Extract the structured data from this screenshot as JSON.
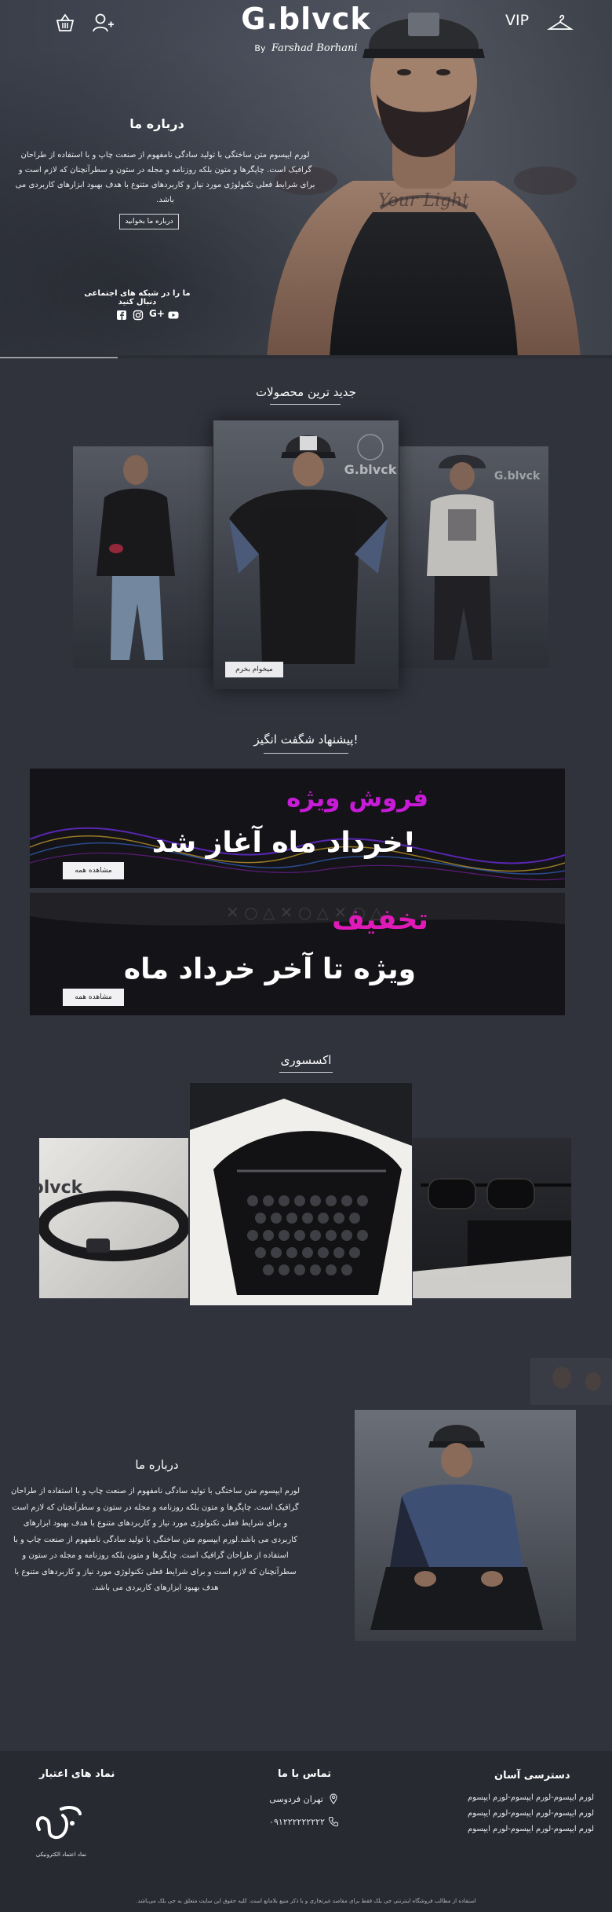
{
  "header": {
    "brand": "G.blvck",
    "by_label": "By",
    "signature": "Farshad Borhani",
    "vip_label": "VIP"
  },
  "hero": {
    "about_title": "درباره ما",
    "about_text": "لورم ایپسوم متن ساختگی با تولید سادگی نامفهوم از صنعت چاپ و با استفاده از طراحان گرافیک است. چاپگرها و متون بلکه روزنامه و مجله در ستون و سطرآنچنان که لازم است و برای شرایط فعلی تکنولوژی مورد نیاز و کاربردهای متنوع با هدف بهبود ابزارهای کاربردی می باشد.",
    "read_more": "درباره ما بخوانید",
    "follow_text": "ما را در شبکه های اجتماعی دنبال کنید"
  },
  "new_products": {
    "title": "جدید ترین محصولات",
    "buy_button": "میخوام بخرم",
    "card_logo": "G.blvck"
  },
  "offers": {
    "title": "پیشنهاد شگفت انگیز!",
    "banners": [
      {
        "accent": "فروش ویژه",
        "main": "خرداد ماه آغاز شد!",
        "button": "مشاهده همه",
        "accent_color": "#c81bd8"
      },
      {
        "accent": "تخفیف",
        "main": "ویژه تا آخر خرداد ماه",
        "button": "مشاهده همه",
        "accent_color": "#e01ab8"
      }
    ]
  },
  "accessories": {
    "title": "اکسسوری",
    "watermark": "blvck"
  },
  "about2": {
    "title": "درباره ما",
    "text": "لورم ایپسوم متن ساختگی با تولید سادگی نامفهوم از صنعت چاپ و با استفاده از طراحان گرافیک است. چاپگرها و متون بلکه روزنامه و مجله در ستون و سطرآنچنان که لازم است و برای شرایط فعلی تکنولوژی مورد نیاز و کاربردهای متنوع با هدف بهبود ابزارهای کاربردی می باشد.لورم ایپسوم متن ساختگی با تولید سادگی نامفهوم از صنعت چاپ و با استفاده از طراحان گرافیک است. چاپگرها و متون بلکه روزنامه و مجله در ستون و سطرآنچنان که لازم است و برای شرایط فعلی تکنولوژی مورد نیاز و کاربردهای متنوع با هدف بهبود ابزارهای کاربردی می باشد."
  },
  "footer": {
    "quick_access_title": "دسترسی آسان",
    "quick_links": [
      "لورم ایپسوم-لورم ایپسوم-لورم ایپسوم",
      "لورم ایپسوم-لورم ایپسوم-لورم ایپسوم",
      "لورم ایپسوم-لورم ایپسوم-لورم ایپسوم"
    ],
    "contact_title": "تماس با ما",
    "address": "تهران فردوسی",
    "phone": "۰۹۱۲۲۲۲۲۲۲۲۲",
    "trust_title": "نماد های اعتبار",
    "trust_caption": "نماد اعتماد الکترونیکی",
    "copyright": "استفاده از مطالب فروشگاه اینترنتی جی بلک فقط برای مقاصد غیرتجاری و با ذکر منبع بلامانع است. کلیه حقوق این سایت متعلق به جی بلک می‌باشد."
  },
  "colors": {
    "background": "#30323c",
    "footer": "#282a32",
    "banner_accent_1": "#c81bd8",
    "banner_accent_2": "#e01ab8"
  }
}
